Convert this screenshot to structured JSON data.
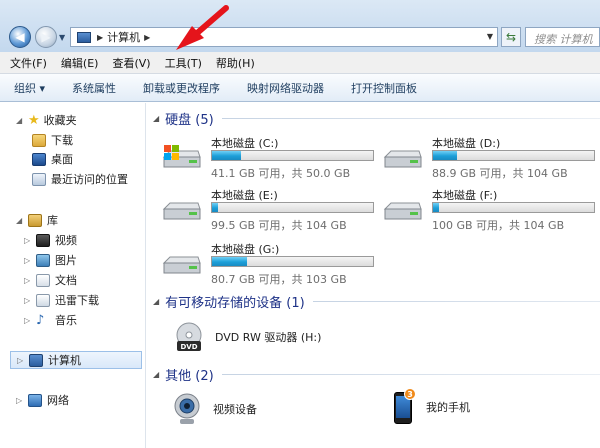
{
  "address": {
    "crumbs": [
      "计算机"
    ],
    "search_placeholder": "搜索 计算机"
  },
  "menu": [
    "文件(F)",
    "编辑(E)",
    "查看(V)",
    "工具(T)",
    "帮助(H)"
  ],
  "commands": [
    "组织 ▾",
    "系统属性",
    "卸载或更改程序",
    "映射网络驱动器",
    "打开控制面板"
  ],
  "nav": {
    "favorites": "收藏夹",
    "fav_items": [
      "下载",
      "桌面",
      "最近访问的位置"
    ],
    "libraries": "库",
    "lib_items": [
      "视频",
      "图片",
      "文档",
      "迅雷下载",
      "音乐"
    ],
    "computer": "计算机",
    "network": "网络"
  },
  "content": {
    "hdd_group": "硬盘 (5)",
    "drives": [
      {
        "name": "本地磁盘 (C:)",
        "info": "41.1 GB 可用，共 50.0 GB",
        "used_fraction": 0.18
      },
      {
        "name": "本地磁盘 (D:)",
        "info": "88.9 GB 可用，共 104 GB",
        "used_fraction": 0.15
      },
      {
        "name": "本地磁盘 (E:)",
        "info": "99.5 GB 可用，共 104 GB",
        "used_fraction": 0.04
      },
      {
        "name": "本地磁盘 (F:)",
        "info": "100 GB 可用，共 104 GB",
        "used_fraction": 0.04
      },
      {
        "name": "本地磁盘 (G:)",
        "info": "80.7 GB 可用，共 103 GB",
        "used_fraction": 0.22
      }
    ],
    "removable_group": "有可移动存储的设备 (1)",
    "dvd": "DVD RW 驱动器 (H:)",
    "other_group": "其他 (2)",
    "others": [
      "视频设备",
      "我的手机"
    ],
    "phone_badge": "3"
  },
  "colors": {
    "accent_arrow": "#e5141b",
    "group_title": "#1e3287",
    "bar_fill": "#1d9fd8"
  }
}
